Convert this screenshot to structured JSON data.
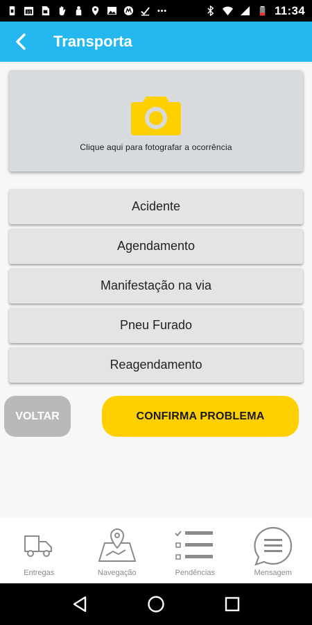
{
  "status_bar": {
    "time": "11:34",
    "icons": [
      "phone-lock-icon",
      "calendar-icon",
      "sim-icon",
      "hand-icon",
      "person-icon",
      "location-icon",
      "image-icon",
      "motorola-icon",
      "download-icon",
      "more-icon",
      "bluetooth-icon",
      "wifi-icon",
      "signal-icon",
      "battery-icon"
    ]
  },
  "app_bar": {
    "title": "Transporta",
    "back_icon": "chevron-left-icon",
    "color": "#25b8f0"
  },
  "photo_card": {
    "label": "Clique aqui para fotografar a ocorrência",
    "icon": "camera-icon",
    "icon_color": "#ffd000"
  },
  "options": [
    {
      "label": "Acidente"
    },
    {
      "label": "Agendamento"
    },
    {
      "label": "Manifestação na via"
    },
    {
      "label": "Pneu Furado"
    },
    {
      "label": "Reagendamento"
    }
  ],
  "actions": {
    "voltar": "VOLTAR",
    "confirma": "CONFIRMA PROBLEMA",
    "confirma_color": "#ffd000"
  },
  "bottom_nav": [
    {
      "label": "Entregas",
      "icon": "truck-icon"
    },
    {
      "label": "Navegação",
      "icon": "map-pin-icon"
    },
    {
      "label": "Pendências",
      "icon": "checklist-icon"
    },
    {
      "label": "Mensagem",
      "icon": "chat-bubble-icon"
    }
  ],
  "system_nav": [
    "back-triangle-icon",
    "home-circle-icon",
    "recents-square-icon"
  ]
}
